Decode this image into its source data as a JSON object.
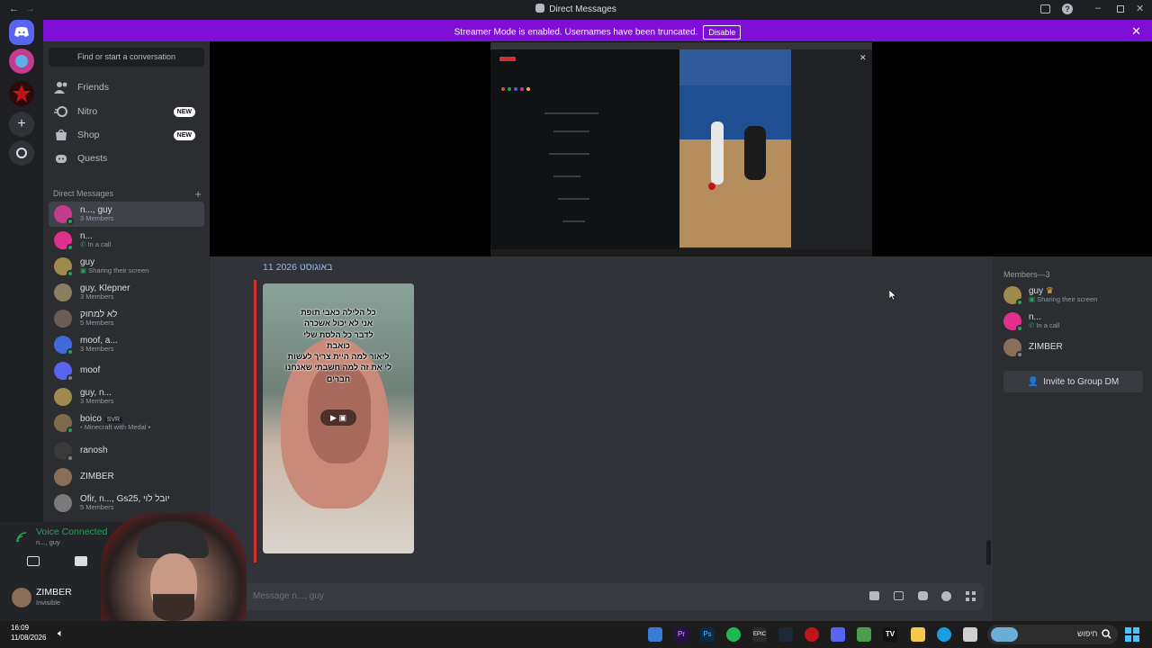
{
  "window": {
    "title": "Direct Messages"
  },
  "banner": {
    "message": "Streamer Mode is enabled. Usernames have been truncated.",
    "disable_label": "Disable",
    "color": "#7f0fd6"
  },
  "sidebar": {
    "search_placeholder": "Find or start a conversation",
    "nav": [
      {
        "label": "Friends",
        "icon": "friends-icon"
      },
      {
        "label": "Nitro",
        "icon": "nitro-icon",
        "badge": "NEW"
      },
      {
        "label": "Shop",
        "icon": "shop-icon",
        "badge": "NEW"
      },
      {
        "label": "Quests",
        "icon": "quests-icon"
      }
    ],
    "dm_header": "Direct Messages",
    "dms": [
      {
        "name": "n..., guy",
        "sub": "3 Members"
      },
      {
        "name": "n...",
        "sub": "In a call"
      },
      {
        "name": "guy",
        "sub": "Sharing their screen"
      },
      {
        "name": "guy, Klepner",
        "sub": "3 Members"
      },
      {
        "name": "לא למחוק",
        "sub": "5 Members"
      },
      {
        "name": "moof, a...",
        "sub": "3 Members"
      },
      {
        "name": "moof",
        "sub": ""
      },
      {
        "name": "guy, n...",
        "sub": "3 Members"
      },
      {
        "name": "boico",
        "tag": "SVR",
        "sub": "Minecraft with Medal •"
      },
      {
        "name": "ranosh",
        "sub": ""
      },
      {
        "name": "ZIMBER",
        "sub": ""
      },
      {
        "name": "Ofir, n..., Gs25, יובל לוי",
        "sub": "5 Members"
      }
    ]
  },
  "voice": {
    "status": "Voice Connected",
    "channel": "n..., guy"
  },
  "user": {
    "name": "ZIMBER",
    "status": "Invisible"
  },
  "chat": {
    "date": "11 באוגוסט 2026",
    "video_caption": [
      "כל הלילה כאבי תופת",
      "אני לא יכול אשכרה",
      "לדבר כל הלסת שלי",
      "כואבת",
      "ליאור למה היית צריך לעשות",
      "לי את זה למה חשבתי שאנחנו",
      "חברים"
    ],
    "composer_placeholder": "Message n..., guy"
  },
  "members": {
    "header": "Members—3",
    "list": [
      {
        "name": "guy",
        "sub": "Sharing their screen"
      },
      {
        "name": "n...",
        "sub": "In a call"
      },
      {
        "name": "ZIMBER",
        "sub": ""
      }
    ],
    "invite_label": "Invite to Group DM"
  },
  "taskbar": {
    "time": "16:09",
    "date": "11/08/2026",
    "search_label": "חיפוש"
  }
}
